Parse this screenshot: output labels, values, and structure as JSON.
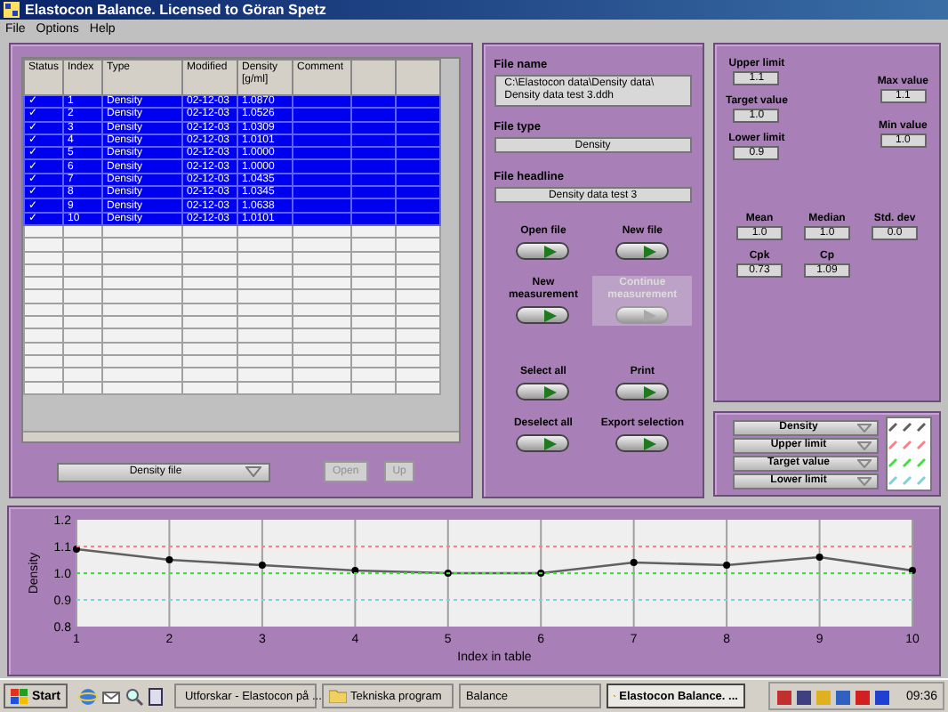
{
  "window": {
    "title": "Elastocon Balance. Licensed to Göran Spetz"
  },
  "menu": [
    "File",
    "Options",
    "Help"
  ],
  "table": {
    "columns": [
      "Status",
      "Index",
      "Type",
      "Modified",
      "Density [g/ml]",
      "Comment"
    ],
    "rows": [
      {
        "status": "✓",
        "index": "1",
        "type": "Density",
        "modified": "02-12-03",
        "density": "1.0870",
        "selected": true
      },
      {
        "status": "✓",
        "index": "2",
        "type": "Density",
        "modified": "02-12-03",
        "density": "1.0526",
        "selected": true
      },
      {
        "status": "✓",
        "index": "3",
        "type": "Density",
        "modified": "02-12-03",
        "density": "1.0309",
        "selected": true
      },
      {
        "status": "✓",
        "index": "4",
        "type": "Density",
        "modified": "02-12-03",
        "density": "1.0101",
        "selected": true
      },
      {
        "status": "✓",
        "index": "5",
        "type": "Density",
        "modified": "02-12-03",
        "density": "1.0000",
        "selected": true
      },
      {
        "status": "✓",
        "index": "6",
        "type": "Density",
        "modified": "02-12-03",
        "density": "1.0000",
        "selected": true
      },
      {
        "status": "✓",
        "index": "7",
        "type": "Density",
        "modified": "02-12-03",
        "density": "1.0435",
        "selected": true
      },
      {
        "status": "✓",
        "index": "8",
        "type": "Density",
        "modified": "02-12-03",
        "density": "1.0345",
        "selected": true
      },
      {
        "status": "✓",
        "index": "9",
        "type": "Density",
        "modified": "02-12-03",
        "density": "1.0638",
        "selected": true
      },
      {
        "status": "✓",
        "index": "10",
        "type": "Density",
        "modified": "02-12-03",
        "density": "1.0101",
        "selected": true
      }
    ]
  },
  "file_selector": {
    "value": "Density file"
  },
  "nav_buttons": [
    {
      "label": "Open",
      "disabled": true
    },
    {
      "label": "Up",
      "disabled": true
    }
  ],
  "file_info": [
    {
      "label": "File name",
      "value": "C:\\Elastocon data\\Density data\\ Density data test 3.ddh",
      "kind": "path"
    },
    {
      "label": "File type",
      "value": "Density",
      "kind": "text"
    },
    {
      "label": "File headline",
      "value": "Density data test 3",
      "kind": "text"
    }
  ],
  "actions_top": [
    {
      "label": "Open file",
      "disabled": false
    },
    {
      "label": "New file",
      "disabled": false
    },
    {
      "label": "New measurement",
      "disabled": false
    },
    {
      "label": "Continue measurement",
      "disabled": true
    }
  ],
  "actions_bottom": [
    {
      "label": "Select all",
      "disabled": false
    },
    {
      "label": "Print",
      "disabled": false
    },
    {
      "label": "Deselect all",
      "disabled": false
    },
    {
      "label": "Export selection",
      "disabled": false
    }
  ],
  "limits": [
    {
      "label": "Upper limit",
      "value": "1.1"
    },
    {
      "label": "Target value",
      "value": "1.0"
    },
    {
      "label": "Lower limit",
      "value": "0.9"
    }
  ],
  "extremes": [
    {
      "label": "Max value",
      "value": "1.1"
    },
    {
      "label": "Min value",
      "value": "1.0"
    }
  ],
  "statistics": [
    {
      "label": "Mean",
      "value": "1.0"
    },
    {
      "label": "Median",
      "value": "1.0"
    },
    {
      "label": "Std. dev",
      "value": "0.0"
    },
    {
      "label": "Cpk",
      "value": "0.73"
    },
    {
      "label": "Cp",
      "value": "1.09"
    }
  ],
  "chart": {
    "chart_data": {
      "type": "line",
      "xlabel": "Index in table",
      "ylabel": "Density",
      "x": [
        1,
        2,
        3,
        4,
        5,
        6,
        7,
        8,
        9,
        10
      ],
      "xlim": [
        1,
        10
      ],
      "ylim": [
        0.8,
        1.2
      ],
      "grid": true,
      "yticks": [
        {
          "value": 0.8,
          "label": "0.8"
        },
        {
          "value": 0.9,
          "label": "0.9"
        },
        {
          "value": 1.0,
          "label": "1.0"
        },
        {
          "value": 1.1,
          "label": "1.1"
        },
        {
          "value": 1.2,
          "label": "1.2"
        }
      ],
      "xticks": [
        1,
        2,
        3,
        4,
        5,
        6,
        7,
        8,
        9,
        10
      ],
      "series": [
        {
          "name": "Density",
          "color": "#606060",
          "marker": "circle",
          "line_style": "solid",
          "values": [
            1.09,
            1.05,
            1.03,
            1.01,
            1.0,
            1.0,
            1.04,
            1.03,
            1.06,
            1.01
          ]
        },
        {
          "name": "Upper limit",
          "color": "#ff8080",
          "line_style": "dashed",
          "values": [
            1.1,
            1.1,
            1.1,
            1.1,
            1.1,
            1.1,
            1.1,
            1.1,
            1.1,
            1.1
          ]
        },
        {
          "name": "Target value",
          "color": "#40e040",
          "line_style": "dashed",
          "values": [
            1.0,
            1.0,
            1.0,
            1.0,
            1.0,
            1.0,
            1.0,
            1.0,
            1.0,
            1.0
          ]
        },
        {
          "name": "Lower limit",
          "color": "#80d0e0",
          "line_style": "dashed",
          "values": [
            0.9,
            0.9,
            0.9,
            0.9,
            0.9,
            0.9,
            0.9,
            0.9,
            0.9,
            0.9
          ]
        }
      ]
    }
  },
  "taskbar": {
    "start": "Start",
    "tasks": [
      {
        "label": "Utforskar - Elastocon på ...",
        "selected": false
      },
      {
        "label": "Tekniska program",
        "selected": false
      },
      {
        "label": "Balance",
        "selected": false
      },
      {
        "label": "Elastocon Balance. ...",
        "selected": true
      }
    ],
    "clock": "09:36"
  }
}
